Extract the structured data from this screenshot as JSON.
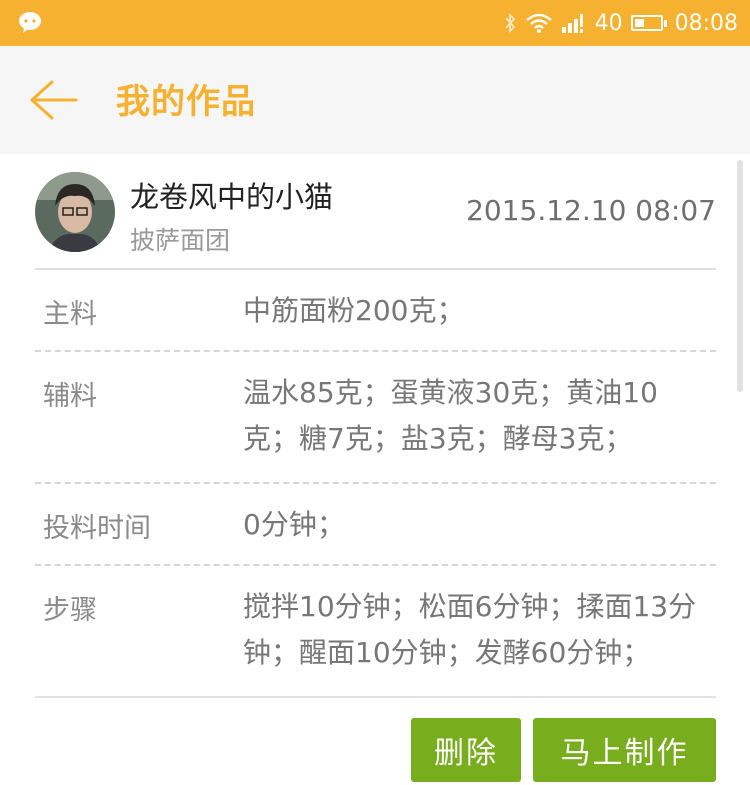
{
  "status_bar": {
    "app_icon": "wechat-icon",
    "network": "40",
    "time": "08:08",
    "color": "#f5b12f"
  },
  "title_bar": {
    "back_icon": "back-arrow-icon",
    "title": "我的作品"
  },
  "post": {
    "username": "龙卷风中的小猫",
    "category": "披萨面团",
    "datetime": "2015.12.10 08:07",
    "rows": [
      {
        "label": "主料",
        "value": "中筋面粉200克；"
      },
      {
        "label": "辅料",
        "value": "温水85克；蛋黄液30克；黄油10克；糖7克；盐3克；酵母3克；"
      },
      {
        "label": "投料时间",
        "value": "0分钟；"
      },
      {
        "label": "步骤",
        "value": "搅拌10分钟；松面6分钟；揉面13分钟；醒面10分钟；发酵60分钟；"
      }
    ]
  },
  "actions": {
    "delete_label": "删除",
    "make_label": "马上制作",
    "button_color": "#78ad1e"
  }
}
